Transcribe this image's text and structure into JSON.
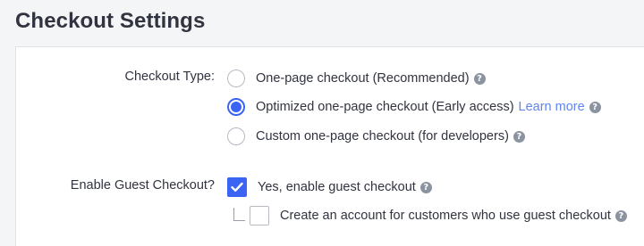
{
  "page": {
    "title": "Checkout Settings"
  },
  "checkout_type": {
    "label": "Checkout Type:",
    "selected_index": 1,
    "options": [
      {
        "label": "One-page checkout (Recommended)",
        "help_icon": "question-circle-icon"
      },
      {
        "label": "Optimized one-page checkout (Early access)",
        "link": "Learn more",
        "help_icon": "question-circle-icon"
      },
      {
        "label": "Custom one-page checkout (for developers)",
        "help_icon": "question-circle-icon"
      }
    ]
  },
  "guest_checkout": {
    "label": "Enable Guest Checkout?",
    "enable_label": "Yes, enable guest checkout",
    "enabled": true,
    "create_account_label": "Create an account for customers who use guest checkout",
    "create_account": false
  },
  "colors": {
    "accent": "#3c64f4",
    "link": "#5f85f2",
    "text": "#313440",
    "help_icon": "#8c93a0",
    "background": "#f4f5f7"
  }
}
